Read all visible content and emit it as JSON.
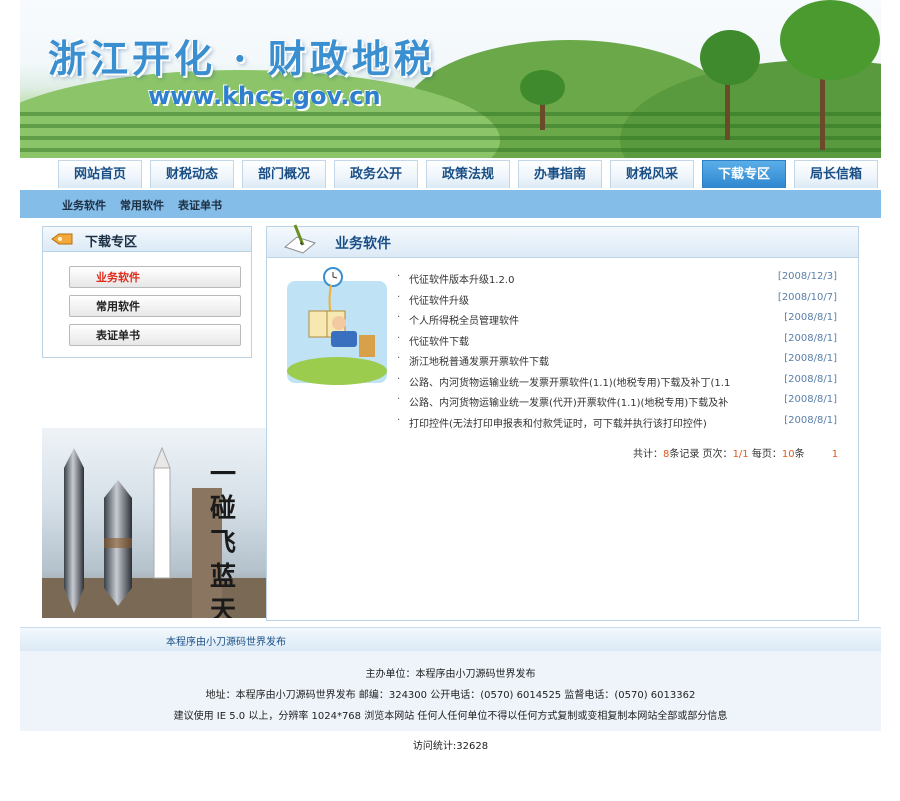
{
  "banner": {
    "title": "浙江开化 · 财政地税",
    "url": "www.khcs.gov.cn"
  },
  "nav": {
    "items": [
      "网站首页",
      "财税动态",
      "部门概况",
      "政务公开",
      "政策法规",
      "办事指南",
      "财税风采",
      "下载专区",
      "局长信箱"
    ],
    "active": "下载专区"
  },
  "subnav": {
    "items": [
      "业务软件",
      "常用软件",
      "表证单书"
    ]
  },
  "sidebar": {
    "title": "下载专区",
    "items": [
      {
        "label": "业务软件",
        "active": true
      },
      {
        "label": "常用软件",
        "active": false
      },
      {
        "label": "表证单书",
        "active": false
      }
    ],
    "image_text": "一碰飞蓝天"
  },
  "main": {
    "title": "业务软件",
    "list": [
      {
        "title": "代征软件版本升级1.2.0",
        "date": "[2008/12/3]"
      },
      {
        "title": "代征软件升级",
        "date": "[2008/10/7]"
      },
      {
        "title": "个人所得税全员管理软件",
        "date": "[2008/8/1]"
      },
      {
        "title": "代征软件下载",
        "date": "[2008/8/1]"
      },
      {
        "title": "浙江地税普通发票开票软件下载",
        "date": "[2008/8/1]"
      },
      {
        "title": "公路、内河货物运输业统一发票开票软件(1.1)(地税专用)下载及补丁(1.1",
        "date": "[2008/8/1]"
      },
      {
        "title": "公路、内河货物运输业统一发票(代开)开票软件(1.1)(地税专用)下载及补",
        "date": "[2008/8/1]"
      },
      {
        "title": "打印控件(无法打印申报表和付款凭证时，可下载并执行该打印控件)",
        "date": "[2008/8/1]"
      }
    ],
    "pager": {
      "total_label": "共计：",
      "total": "8",
      "total_suffix": "条记录  页次：",
      "page": "1/1",
      "per_label": "  每页：",
      "per": "10",
      "per_suffix": "条",
      "page_link": "1"
    }
  },
  "footer": {
    "bar_text": "本程序由小刀源码世界发布",
    "line1": "主办单位：本程序由小刀源码世界发布",
    "line2": "地址：本程序由小刀源码世界发布    邮编：324300   公开电话：(0570) 6014525   监督电话：(0570) 6013362",
    "line3": "建议使用 IE 5.0 以上，分辨率 1024*768 浏览本网站     任何人任何单位不得以任何方式复制或变相复制本网站全部或部分信息",
    "counter_label": "访问统计:",
    "counter": "32628"
  },
  "colors": {
    "accent": "#2f86cf",
    "subnav": "#84bde7",
    "link_red": "#e05a1a",
    "date": "#5a7fa8"
  }
}
